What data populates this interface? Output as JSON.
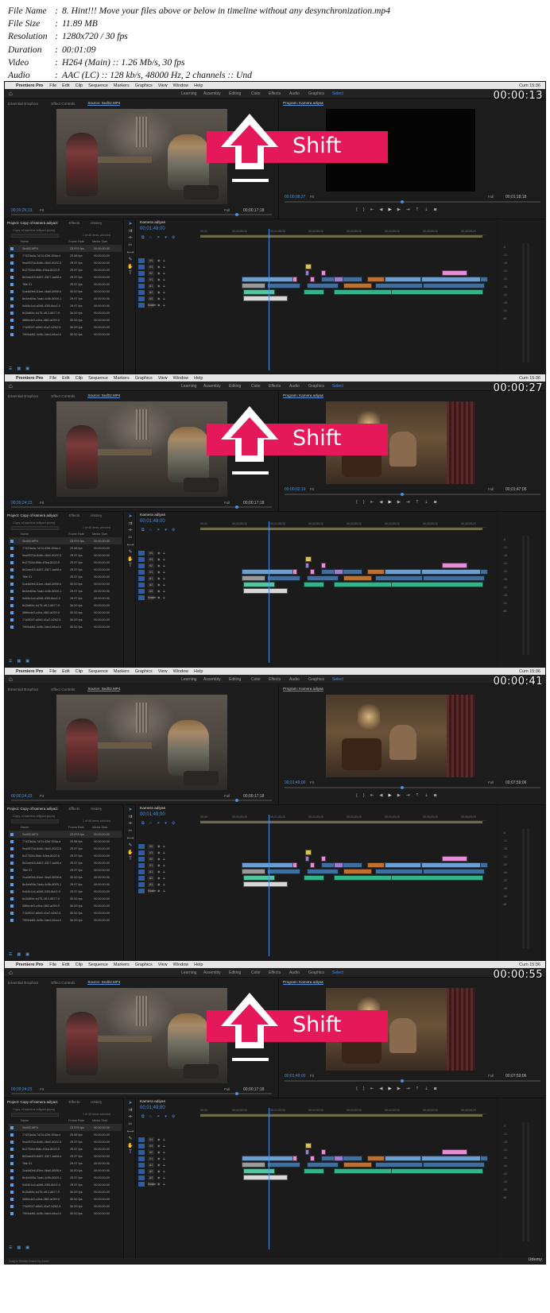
{
  "header": {
    "rows": [
      {
        "key": "File Name",
        "sep": ":",
        "value": "8. Hint!!! Move your files above or below in timeline without any desynchronization.mp4"
      },
      {
        "key": "File Size",
        "sep": ":",
        "value": "11.89 MB"
      },
      {
        "key": "Resolution",
        "sep": ":",
        "value": "1280x720 / 30 fps"
      },
      {
        "key": "Duration",
        "sep": ":",
        "value": "00:01:09"
      },
      {
        "key": "Video",
        "sep": ":",
        "value": "H264 (Main) :: 1.26 Mb/s, 30 fps"
      },
      {
        "key": "Audio",
        "sep": ":",
        "value": "AAC (LC) :: 128 kb/s, 48000 Hz, 2 channels :: Und"
      }
    ]
  },
  "app": {
    "apple": "",
    "name": "Premiere Pro",
    "menu": [
      "File",
      "Edit",
      "Clip",
      "Sequence",
      "Markers",
      "Graphics",
      "View",
      "Window",
      "Help"
    ],
    "tray": "Cum 15:36",
    "workspaces": [
      "Learning",
      "Assembly",
      "Editing",
      "Color",
      "Effects",
      "Audio",
      "Graphics",
      "Select"
    ],
    "source_tabs": [
      "Essential Graphics",
      "Effect Controls",
      "Source: Sed02.MP4"
    ],
    "program_tab": "Program: Kamera adiyas",
    "project_tabs": [
      "Project: Copy of kamera adiyazi",
      "Effects",
      "History"
    ],
    "project_path": "Copy of kamera adiyazi.prproj",
    "project_count": "1 of 46 items selected",
    "project_columns": [
      "Name",
      "Frame Rate",
      "Media Start"
    ],
    "project_items": [
      {
        "name": "Sed02.MP4",
        "fps": "23.976 fps",
        "start": "00:00:00:00"
      },
      {
        "name": "77420a4a-7a7d-42bf-92da-e",
        "fps": "29.98 fps",
        "start": "00:00:00:00"
      },
      {
        "name": "9ea9570d-8c6b-46e0-8022-5",
        "fps": "29.97 fps",
        "start": "00:00:00:00"
      },
      {
        "name": "8c2732fd-f5de-43ea-8022-5",
        "fps": "29.97 fps",
        "start": "00:00:00:00"
      },
      {
        "name": "8b2aed15-8d57-4327-aa08-e",
        "fps": "29.97 fps",
        "start": "00:00:00:00"
      },
      {
        "name": "Title 01",
        "fps": "29.97 fps",
        "start": "00:00:00:00"
      },
      {
        "name": "2ca4d0b6-81ee-4ba0-8698-b",
        "fps": "30.00 fps",
        "start": "00:00:00:00"
      },
      {
        "name": "8e4eb69a-7aab-4c5b-8009-1",
        "fps": "29.97 fps",
        "start": "00:00:00:00"
      },
      {
        "name": "9c64b1a4-a2d8-43f3-8cb2-0",
        "fps": "29.97 fps",
        "start": "00:00:00:00"
      },
      {
        "name": "8c2b8f4e-b475-4f12-8877-9",
        "fps": "30.00 fps",
        "start": "00:00:00:00"
      },
      {
        "name": "08f6ede3-c4ea-4f62-a059-9",
        "fps": "30.00 fps",
        "start": "00:00:00:00"
      },
      {
        "name": "77d2f047-d6b0-41a7-b2b2-5",
        "fps": "30.00 fps",
        "start": "00:00:00:00"
      },
      {
        "name": "79b5dd61-4c5b-4de4-b6cd-0",
        "fps": "30.00 fps",
        "start": "00:00:00:00"
      }
    ],
    "timeline_tab": "Kamera adiyas",
    "ruler": [
      "00;00",
      "00;00;59;26",
      "00;01;59;28",
      "00;02;59;26",
      "00;03;59;26",
      "00;04;59;26",
      "00;05;59;26",
      "00;06;59;29"
    ],
    "tracks": [
      "V4",
      "V3",
      "V2",
      "V1",
      "A1",
      "A2",
      "A3",
      "Master"
    ],
    "fit": "Fit",
    "full": "Full",
    "src_duration": "00;00;17;18",
    "udemy": "Udemy",
    "status": "Drag to Shuttle Frame-by-frame"
  },
  "frames": [
    {
      "timestamp": "00:00:13",
      "src_tc": "00;00;26;23",
      "prg_tc": "00;00;08;27",
      "prg_dur": "00;01;18;18",
      "tl_tc": "00;01;49;00",
      "shift": true,
      "prg_view": "black"
    },
    {
      "timestamp": "00:00:27",
      "src_tc": "00;00;24;23",
      "prg_tc": "00;00;02;19",
      "prg_dur": "00;01;47;05",
      "tl_tc": "00;01;49;00",
      "shift": true,
      "prg_view": "room"
    },
    {
      "timestamp": "00:00:41",
      "src_tc": "00;00;24;23",
      "prg_tc": "00;01;49;00",
      "prg_dur": "00;07;59;06",
      "tl_tc": "00;01;49;00",
      "shift": false,
      "prg_view": "room"
    },
    {
      "timestamp": "00:00:55",
      "src_tc": "00;00;24;23",
      "prg_tc": "00;01;49;00",
      "prg_dur": "00;07;59;06",
      "tl_tc": "00;01;49;00",
      "shift": true,
      "prg_view": "room"
    }
  ],
  "overlay": {
    "shift_label": "Shift"
  },
  "colors": {
    "shift_band": "#e5195a",
    "accent": "#4a90e2",
    "audio_clip": "#2fb58a"
  }
}
